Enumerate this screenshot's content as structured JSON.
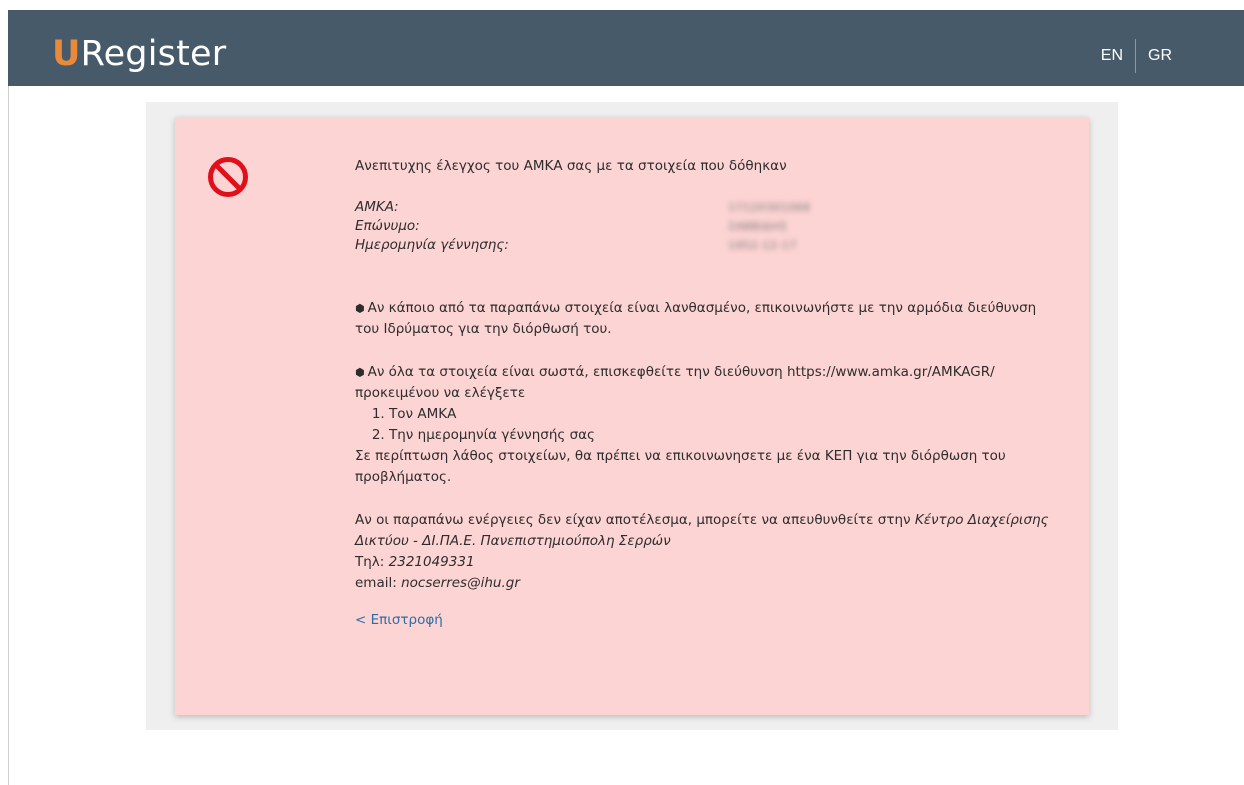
{
  "header": {
    "logo_initial": "U",
    "logo_rest": "Register",
    "lang_en": "EN",
    "lang_gr": "GR"
  },
  "colors": {
    "header_bg": "#465a69",
    "logo_accent": "#e98a3b",
    "card_bg": "#fdd4d4",
    "error_icon": "#e0101b",
    "link": "#2e6da4"
  },
  "error": {
    "icon": "ban-icon",
    "title": "Ανεπιτυχης έλεγχος του ΑΜΚΑ σας με τα στοιχεία που δόθηκαν",
    "fields": [
      {
        "label": "ΑΜΚΑ:",
        "value": "17120301068"
      },
      {
        "label": "Επώνυμο:",
        "value": "ΣΑΒΒΙΔΗΣ"
      },
      {
        "label": "Ημερομηνία γέννησης:",
        "value": "1952-12-17"
      }
    ],
    "bullet1": "Αν κάποιο από τα παραπάνω στοιχεία είναι λανθασμένο, επικοινωνήστε με την αρμόδια διεύθυνση του Ιδρύματος για την διόρθωσή του.",
    "bullet2_intro": "Αν όλα τα στοιχεία είναι σωστά, επισκεφθείτε την διεύθυνση https://www.amka.gr/AMKAGR/ προκειμένου να ελέγξετε",
    "checks": [
      "Τον ΑΜΚΑ",
      "Την ημερομηνία γέννησής σας"
    ],
    "bullet2_outro": "Σε περίπτωση λάθος στοιχείων, θα πρέπει να επικοινωνησετε με ένα ΚΕΠ για την διόρθωση του προβλήματος.",
    "contact_intro": "Αν οι παραπάνω ενέργειες δεν είχαν αποτέλεσμα, μπορείτε να απευθυνθείτε στην",
    "contact_org": "Κέντρο Διαχείρισης Δικτύου - ΔΙ.ΠΑ.Ε. Πανεπιστημιούπολη Σερρών",
    "phone_label": "Τηλ:",
    "phone": "2321049331",
    "email_label": "email:",
    "email": "nocserres@ihu.gr",
    "back_label": "< Επιστροφή"
  }
}
